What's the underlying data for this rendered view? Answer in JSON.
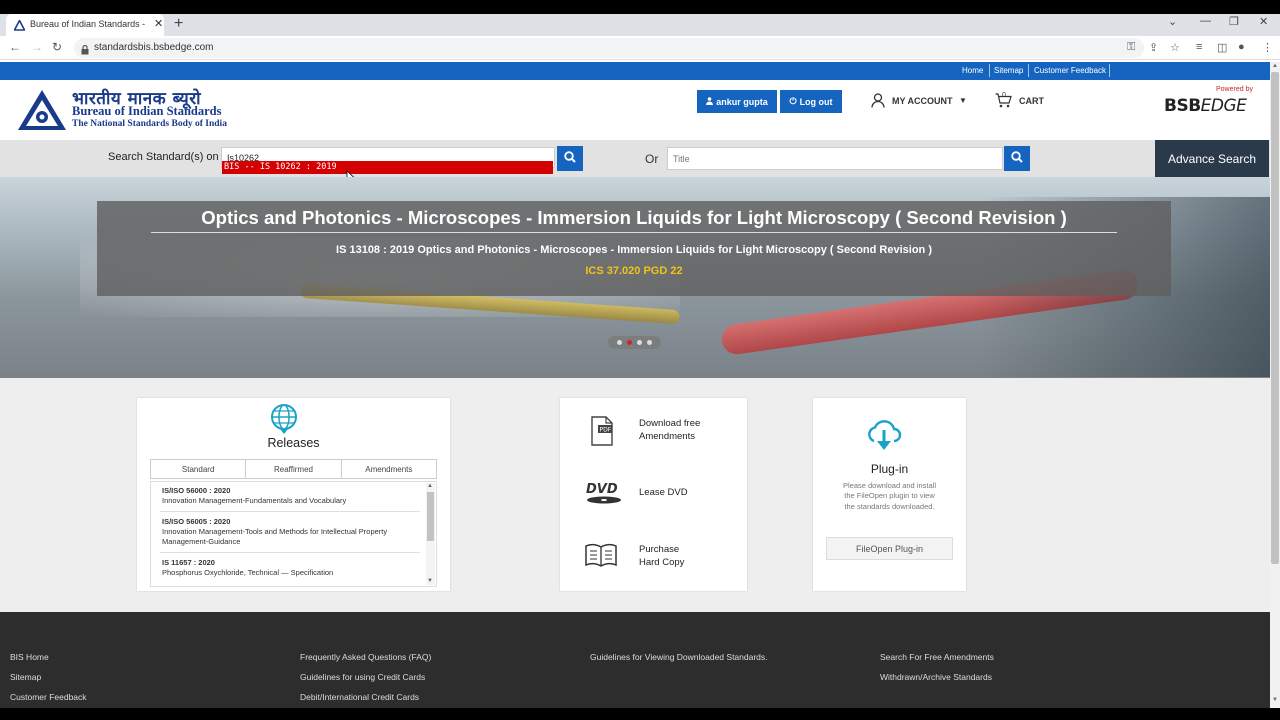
{
  "browser": {
    "tab_title": "Bureau of Indian Standards - e-S",
    "url": "standardsbis.bsbedge.com",
    "new_tab": "+",
    "close_tab": "✕"
  },
  "topnav": {
    "home": "Home",
    "sitemap": "Sitemap",
    "feedback": "Customer Feedback"
  },
  "logo": {
    "hindi": "भारतीय मानक ब्यूरो",
    "english": "Bureau of Indian Standards",
    "tagline": "The National Standards Body of India"
  },
  "header": {
    "user_label": "ankur gupta",
    "logout_label": "Log out",
    "account_label": "MY ACCOUNT",
    "cart_label": "CART",
    "cart_count": "0",
    "powered_by": "Powered by",
    "brand_bsb": "BSB",
    "brand_edge": "EDGE"
  },
  "search": {
    "label": "Search Standard(s) on",
    "value": "Is10262",
    "suggestion": "BIS -- IS 10262 : 2019",
    "or_label": "Or",
    "title_placeholder": "Title",
    "advance_label": "Advance Search"
  },
  "hero": {
    "title": "Optics and Photonics - Microscopes - Immersion Liquids for Light Microscopy ( Second Revision )",
    "subtitle": "IS 13108 : 2019 Optics and Photonics - Microscopes - Immersion Liquids for Light Microscopy ( Second Revision )",
    "ics": "ICS 37.020 PGD 22",
    "active_slide": 2,
    "slide_count": 4
  },
  "releases": {
    "title": "Releases",
    "tabs": [
      "Standard",
      "Reaffirmed",
      "Amendments"
    ],
    "items": [
      {
        "code": "IS/ISO 56000 : 2020",
        "desc": "Innovation Management-Fundamentals and Vocabulary"
      },
      {
        "code": "IS/ISO 56005 : 2020",
        "desc": "Innovation Management-Tools and Methods for Intellectual Property Management-Guidance"
      },
      {
        "code": "IS 11657 : 2020",
        "desc": "Phosphorus Oxychloride, Technical — Specification"
      }
    ]
  },
  "services": {
    "download": "Download free Amendments",
    "dvd_label": "DVD",
    "lease": "Lease DVD",
    "purchase": "Purchase Hard Copy",
    "pdf_label": "PDF"
  },
  "plugin": {
    "title": "Plug-in",
    "desc": "Please download and install the FileOpen plugin to view the standards downloaded.",
    "button": "FileOpen Plug-in"
  },
  "footer": {
    "col1": [
      "BIS Home",
      "Sitemap",
      "Customer Feedback"
    ],
    "col2": [
      "Frequently Asked Questions (FAQ)",
      "Guidelines for using Credit Cards",
      "Debit/International Credit Cards"
    ],
    "col3": [
      "Guidelines for Viewing Downloaded Standards."
    ],
    "col4": [
      "Search For Free Amendments",
      "Withdrawn/Archive Standards"
    ]
  },
  "colors": {
    "primary_blue": "#1565c0",
    "suggest_red": "#d50000",
    "ics_yellow": "#f0c419",
    "footer_bg": "#2d2d2d"
  }
}
